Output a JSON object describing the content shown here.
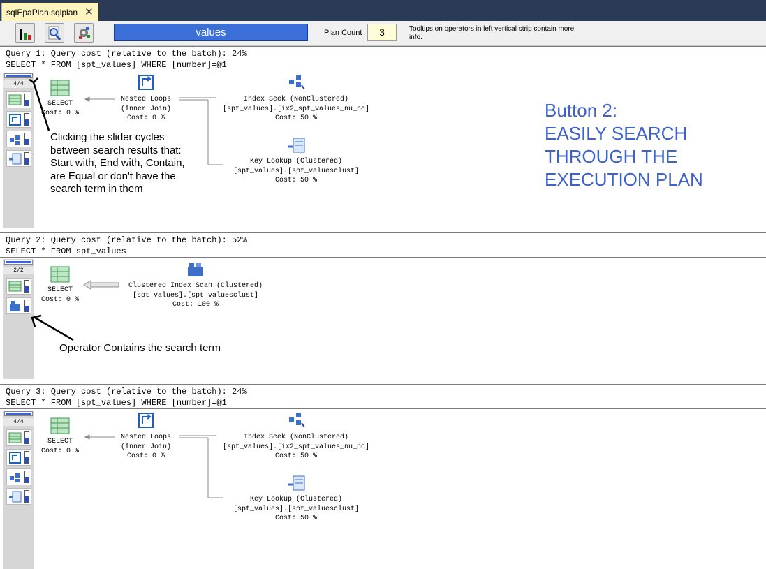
{
  "tab": {
    "title": "sqlEpaPlan.sqlplan",
    "close": "✕"
  },
  "toolbar": {
    "search_value": "values",
    "plan_count_label": "Plan Count",
    "plan_count_value": "3",
    "tooltip": "Tooltips on operators in left vertical strip contain more info."
  },
  "queries": [
    {
      "header": "Query 1: Query cost (relative to the batch): 24%",
      "sql": "SELECT * FROM [spt_values] WHERE [number]=@1",
      "count": "4/4",
      "select": {
        "l1": "SELECT",
        "l2": "Cost: 0 %"
      },
      "loops": {
        "l1": "Nested Loops",
        "l2": "(Inner Join)",
        "l3": "Cost: 0 %"
      },
      "seek": {
        "l1": "Index Seek (NonClustered)",
        "l2": "[spt_values].[ix2_spt_values_nu_nc]",
        "l3": "Cost: 50 %"
      },
      "lookup": {
        "l1": "Key Lookup (Clustered)",
        "l2": "[spt_values].[spt_valuesclust]",
        "l3": "Cost: 50 %"
      }
    },
    {
      "header": "Query 2: Query cost (relative to the batch): 52%",
      "sql": "SELECT * FROM spt_values",
      "count": "2/2",
      "select": {
        "l1": "SELECT",
        "l2": "Cost: 0 %"
      },
      "scan": {
        "l1": "Clustered Index Scan (Clustered)",
        "l2": "[spt_values].[spt_valuesclust]",
        "l3": "Cost: 100 %"
      }
    },
    {
      "header": "Query 3: Query cost (relative to the batch): 24%",
      "sql": "SELECT * FROM [spt_values] WHERE [number]=@1",
      "count": "4/4",
      "select": {
        "l1": "SELECT",
        "l2": "Cost: 0 %"
      },
      "loops": {
        "l1": "Nested Loops",
        "l2": "(Inner Join)",
        "l3": "Cost: 0 %"
      },
      "seek": {
        "l1": "Index Seek (NonClustered)",
        "l2": "[spt_values].[ix2_spt_values_nu_nc]",
        "l3": "Cost: 50 %"
      },
      "lookup": {
        "l1": "Key Lookup (Clustered)",
        "l2": "[spt_values].[spt_valuesclust]",
        "l3": "Cost: 50 %"
      }
    }
  ],
  "annotations": {
    "slider_note": [
      "Clicking the slider cycles",
      "between search results that:",
      "Start with, End with, Contain,",
      "are Equal or don't have the",
      "search term in them"
    ],
    "contains_note": "Operator Contains the search term",
    "headline": [
      "Button 2:",
      "EASILY SEARCH",
      "THROUGH THE",
      "EXECUTION PLAN"
    ]
  },
  "colors": {
    "accent": "#3d63c9",
    "search_bg": "#3c6fd8",
    "tab_bg": "#fdf4bf"
  }
}
